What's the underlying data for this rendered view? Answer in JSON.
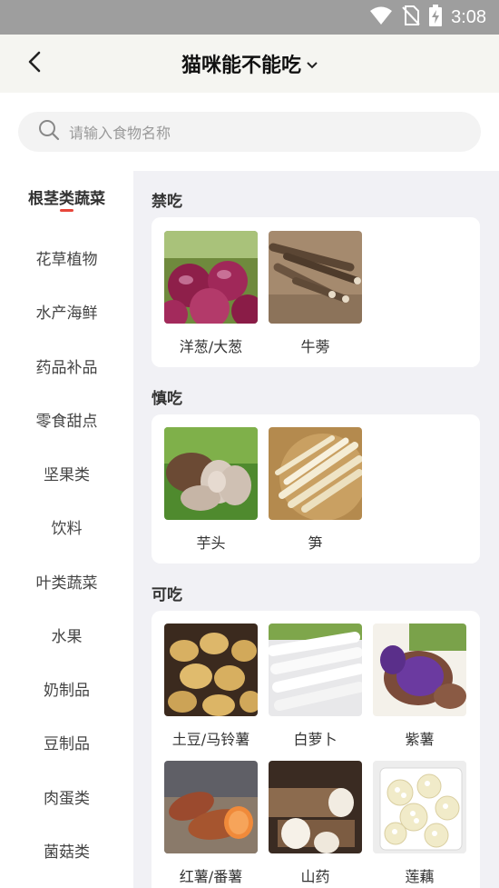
{
  "status_bar": {
    "time": "3:08"
  },
  "header": {
    "title": "猫咪能不能吃"
  },
  "search": {
    "placeholder": "请输入食物名称"
  },
  "categories": [
    "根茎类蔬菜",
    "花草植物",
    "水产海鲜",
    "药品补品",
    "零食甜点",
    "坚果类",
    "饮料",
    "叶类蔬菜",
    "水果",
    "奶制品",
    "豆制品",
    "肉蛋类",
    "菌菇类"
  ],
  "active_category": "根茎类蔬菜",
  "sections": [
    {
      "title": "禁吃",
      "foods": [
        {
          "name": "洋葱/大葱"
        },
        {
          "name": "牛蒡"
        }
      ]
    },
    {
      "title": "慎吃",
      "foods": [
        {
          "name": "芋头"
        },
        {
          "name": "笋"
        }
      ]
    },
    {
      "title": "可吃",
      "foods": [
        {
          "name": "土豆/马铃薯"
        },
        {
          "name": "白萝卜"
        },
        {
          "name": "紫薯"
        },
        {
          "name": "红薯/番薯"
        },
        {
          "name": "山药"
        },
        {
          "name": "莲藕"
        }
      ]
    }
  ],
  "colors": {
    "accent": "#e8463a",
    "status_bar": "#9e9e9e",
    "header_bg": "#f5f5f1",
    "pane_bg": "#f1f1f5"
  }
}
